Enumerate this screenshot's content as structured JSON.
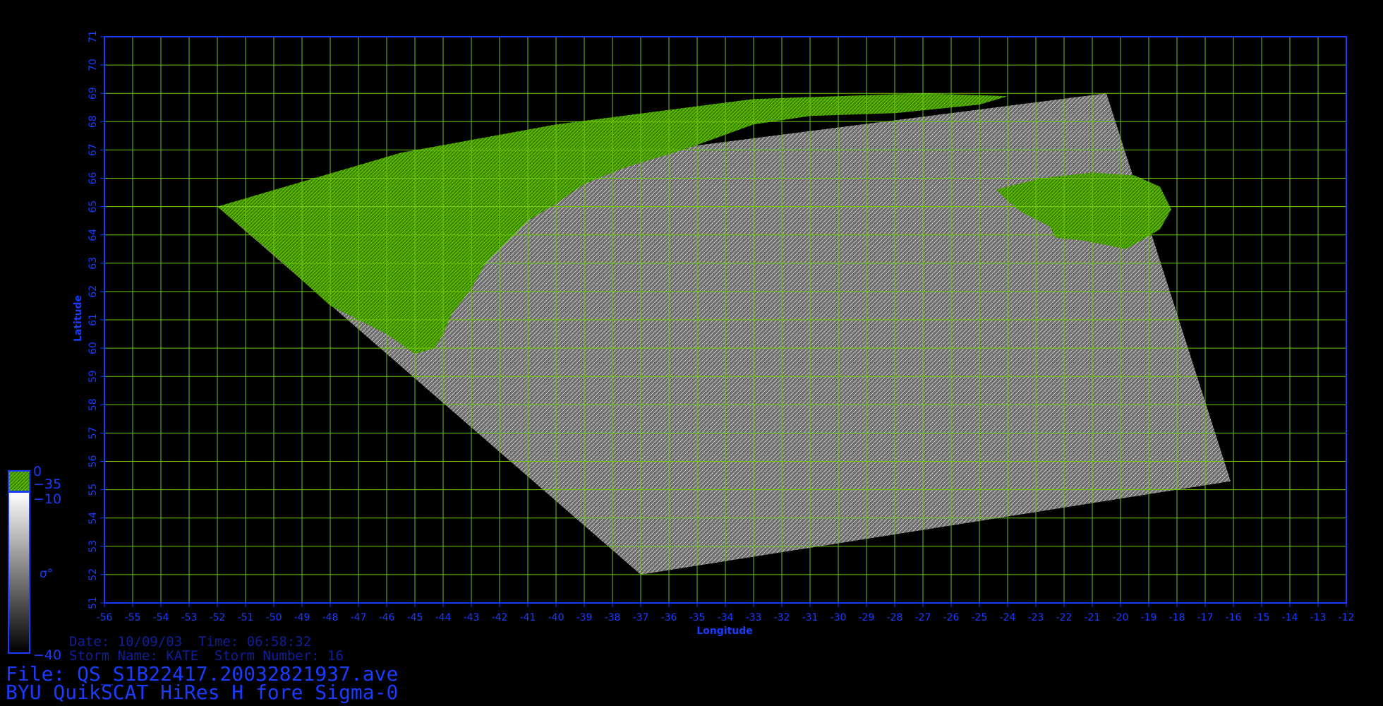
{
  "chart_data": {
    "type": "heatmap",
    "xlabel": "Longitude",
    "ylabel": "Latitude",
    "xlim": [
      -56,
      -12
    ],
    "ylim": [
      51,
      71
    ],
    "x_ticks": [
      -56,
      -55,
      -54,
      -53,
      -52,
      -51,
      -50,
      -49,
      -48,
      -47,
      -46,
      -45,
      -44,
      -43,
      -42,
      -41,
      -40,
      -39,
      -38,
      -37,
      -36,
      -35,
      -34,
      -33,
      -32,
      -31,
      -30,
      -29,
      -28,
      -27,
      -26,
      -25,
      -24,
      -23,
      -22,
      -21,
      -20,
      -19,
      -18,
      -17,
      -16,
      -15,
      -14,
      -13,
      -12
    ],
    "y_ticks": [
      51,
      52,
      53,
      54,
      55,
      56,
      57,
      58,
      59,
      60,
      61,
      62,
      63,
      64,
      65,
      66,
      67,
      68,
      69,
      70,
      71
    ],
    "x_tick_labels": [
      "-56",
      "-55",
      "-54",
      "-53",
      "-52",
      "-51",
      "-50",
      "-49",
      "-48",
      "-47",
      "-46",
      "-45",
      "-44",
      "-43",
      "-42",
      "-41",
      "-40",
      "-39",
      "-38",
      "-37",
      "-36",
      "-35",
      "-34",
      "-33",
      "-32",
      "-31",
      "-30",
      "-29",
      "-28",
      "-27",
      "-26",
      "-25",
      "-24",
      "-23",
      "-22",
      "-21",
      "-20",
      "-19",
      "-18",
      "-17",
      "-16",
      "-15",
      "-14",
      "-13",
      "-12"
    ],
    "y_tick_labels": [
      "51",
      "52",
      "53",
      "54",
      "55",
      "56",
      "57",
      "58",
      "59",
      "60",
      "61",
      "62",
      "63",
      "64",
      "65",
      "66",
      "67",
      "68",
      "69",
      "70",
      "71"
    ],
    "grid": true,
    "swath_corners": [
      [
        -52,
        65
      ],
      [
        -20.5,
        69
      ],
      [
        -16.1,
        55.3
      ],
      [
        -37,
        52
      ]
    ],
    "land_masks": [
      {
        "name": "greenland",
        "outline": [
          [
            -52,
            65
          ],
          [
            -45.5,
            66.9
          ],
          [
            -40,
            67.9
          ],
          [
            -33,
            68.8
          ],
          [
            -27,
            69
          ],
          [
            -24,
            68.9
          ],
          [
            -25,
            68.6
          ],
          [
            -28,
            68.3
          ],
          [
            -31,
            68.2
          ],
          [
            -33,
            67.9
          ],
          [
            -35.5,
            67
          ],
          [
            -37.5,
            66.4
          ],
          [
            -39,
            65.8
          ],
          [
            -40,
            65.1
          ],
          [
            -41,
            64.5
          ],
          [
            -41.7,
            63.8
          ],
          [
            -42.5,
            63
          ],
          [
            -43,
            62.1
          ],
          [
            -43.7,
            61.2
          ],
          [
            -44,
            60.5
          ],
          [
            -44.3,
            60
          ],
          [
            -45,
            59.8
          ],
          [
            -46,
            60.5
          ],
          [
            -48,
            61.5
          ],
          [
            -50,
            63.3
          ]
        ]
      },
      {
        "name": "iceland",
        "outline": [
          [
            -24.4,
            65.6
          ],
          [
            -22.8,
            66
          ],
          [
            -21,
            66.2
          ],
          [
            -19.5,
            66.1
          ],
          [
            -18.6,
            65.7
          ],
          [
            -18.2,
            64.9
          ],
          [
            -18.6,
            64.2
          ],
          [
            -19.8,
            63.5
          ],
          [
            -21.3,
            63.8
          ],
          [
            -22.3,
            63.9
          ],
          [
            -22.5,
            64.3
          ],
          [
            -23.5,
            64.8
          ],
          [
            -24,
            65.2
          ]
        ]
      }
    ],
    "colormap": {
      "label": "σ°",
      "segments": [
        {
          "range": [
            -35,
            0
          ],
          "color": "#3d8a00"
        },
        {
          "range": [
            -40,
            -10
          ],
          "from_color": "#ffffff",
          "to_color": "#000000"
        }
      ],
      "tick_labels": [
        "0",
        "−35",
        "−10",
        "−40"
      ]
    },
    "colors": {
      "axis": "#1a3cff",
      "grid": "#6ec800",
      "land": "#49a400",
      "ocean": "#8a8a8a"
    }
  },
  "info": {
    "date_line": "Date: 10/09/03  Time: 06:58:32",
    "storm_line": "Storm Name: KATE  Storm Number: 16",
    "file_line": "File: QS_S1B22417.20032821937.ave",
    "product_line": "BYU QuikSCAT HiRes H fore Sigma-0"
  }
}
